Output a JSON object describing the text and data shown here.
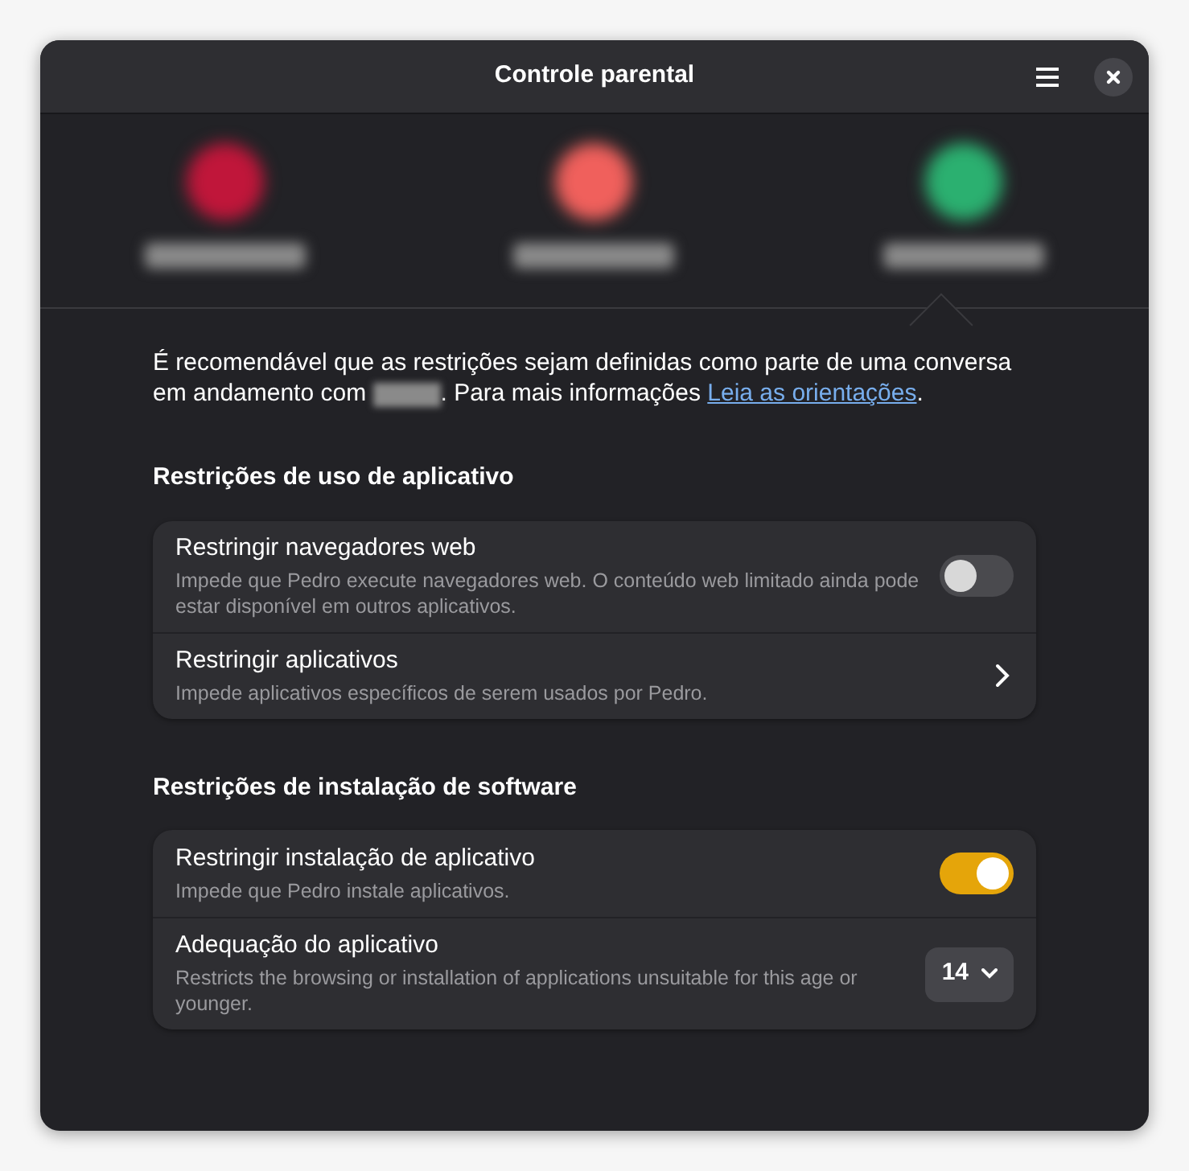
{
  "window": {
    "title": "Controle parental"
  },
  "users": [
    {
      "color": "#c0163a",
      "selected": false
    },
    {
      "color": "#f0605c",
      "selected": false
    },
    {
      "color": "#2bb070",
      "selected": true
    }
  ],
  "notice": {
    "before": "É recomendável que as restrições sejam definidas como parte de uma conversa em andamento com",
    "after": ". Para mais informações ",
    "link": "Leia as orientações",
    "end": "."
  },
  "sections": [
    {
      "title": "Restrições de uso de aplicativo",
      "rows": [
        {
          "kind": "toggle",
          "title": "Restringir navegadores web",
          "subtitle": "Impede que Pedro execute navegadores web. O conteúdo web limitado ainda pode estar disponível em outros aplicativos.",
          "on": false
        },
        {
          "kind": "link",
          "title": "Restringir aplicativos",
          "subtitle": "Impede aplicativos específicos de serem usados por Pedro."
        }
      ]
    },
    {
      "title": "Restrições de instalação de software",
      "rows": [
        {
          "kind": "toggle",
          "title": "Restringir instalação de aplicativo",
          "subtitle": "Impede que Pedro instale aplicativos.",
          "on": true
        },
        {
          "kind": "dropdown",
          "title": "Adequação do aplicativo",
          "subtitle": "Restricts the browsing or installation of applications unsuitable for this age or younger.",
          "value": "14"
        }
      ]
    }
  ]
}
